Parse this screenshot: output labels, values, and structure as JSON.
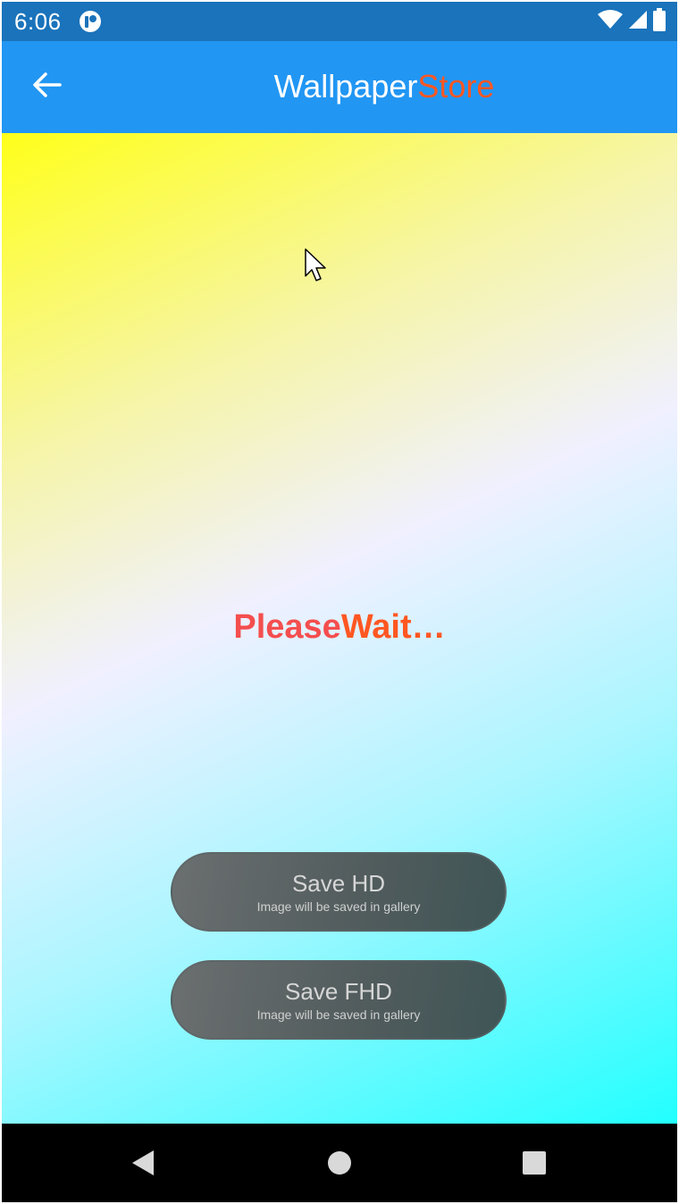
{
  "status_bar": {
    "time": "6:06",
    "app_icon": "notification-app-icon",
    "icons": [
      "wifi-icon",
      "cell-signal-icon",
      "battery-icon"
    ],
    "background": "#1a73bb"
  },
  "app_bar": {
    "back_icon": "arrow-left-icon",
    "title_part_1": "Wallpaper",
    "title_part_2": "Store",
    "background": "#2196f3",
    "accent": "#ff5722"
  },
  "content": {
    "loading_part_1": "Please",
    "loading_part_2": "Wait…",
    "buttons": [
      {
        "label": "Save HD",
        "sublabel": "Image will be saved in gallery"
      },
      {
        "label": "Save FHD",
        "sublabel": "Image will be saved in gallery"
      }
    ]
  },
  "nav_bar": {
    "back_icon": "nav-back-triangle-icon",
    "home_icon": "nav-home-circle-icon",
    "recents_icon": "nav-recents-square-icon"
  }
}
